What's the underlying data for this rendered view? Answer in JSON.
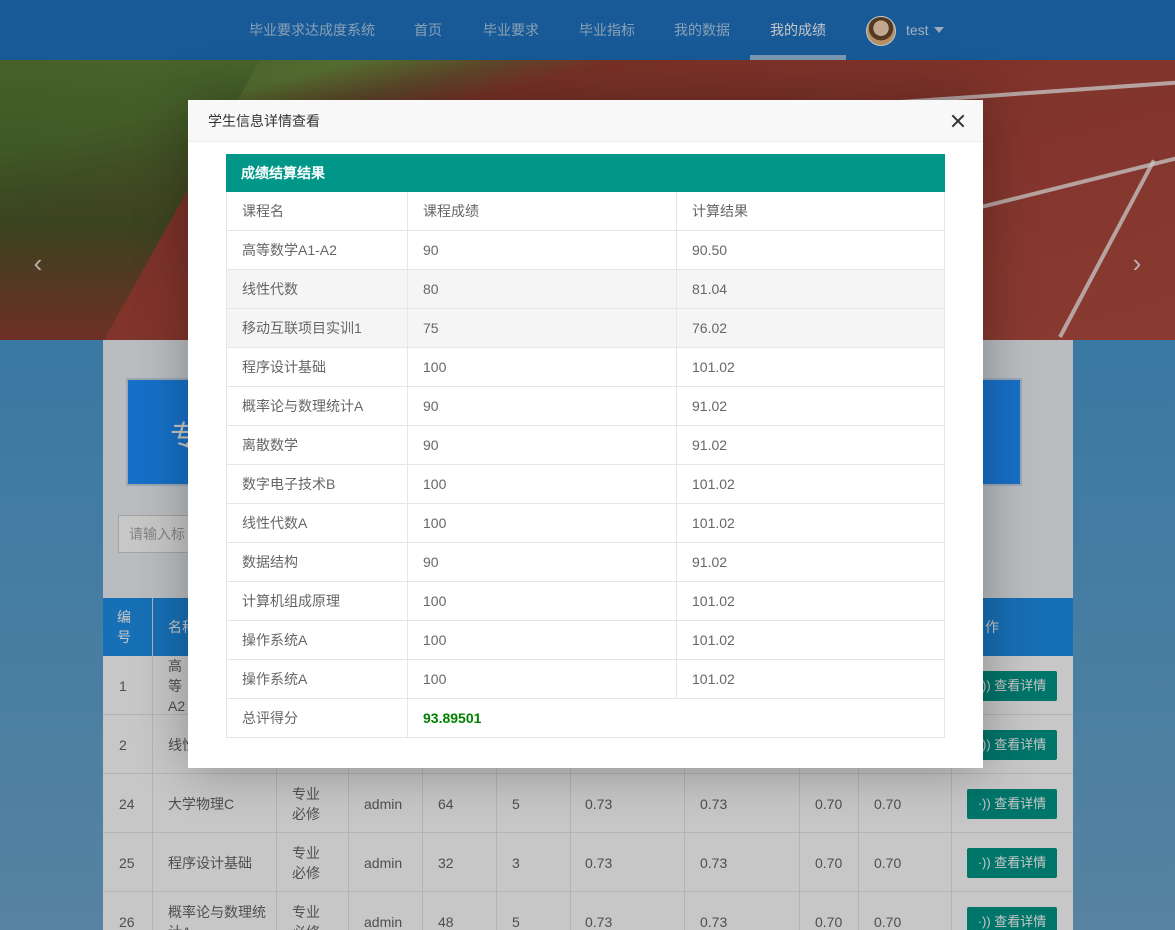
{
  "nav": {
    "items": [
      {
        "label": "毕业要求达成度系统",
        "active": false
      },
      {
        "label": "首页",
        "active": false
      },
      {
        "label": "毕业要求",
        "active": false
      },
      {
        "label": "毕业指标",
        "active": false
      },
      {
        "label": "我的数据",
        "active": false
      },
      {
        "label": "我的成绩",
        "active": true
      }
    ],
    "user": "test"
  },
  "banner": {
    "prev": "‹",
    "next": "›"
  },
  "page": {
    "big_box_text": "专",
    "search_placeholder": "请输入标",
    "grid_headers": [
      "编号",
      "名称",
      "作"
    ],
    "detail_label": "·)) 查看详情",
    "rows": [
      {
        "id": "1",
        "name": "高等A2",
        "type": "",
        "user": "",
        "c5": "",
        "c6": "",
        "c7": "",
        "c8": "",
        "c9": "",
        "c10": ""
      },
      {
        "id": "2",
        "name": "线性",
        "type": "",
        "user": "",
        "c5": "",
        "c6": "",
        "c7": "",
        "c8": "",
        "c9": "",
        "c10": ""
      },
      {
        "id": "24",
        "name": "大学物理C",
        "type": "专业必修",
        "user": "admin",
        "c5": "64",
        "c6": "5",
        "c7": "0.73",
        "c8": "0.73",
        "c9": "0.70",
        "c10": "0.70"
      },
      {
        "id": "25",
        "name": "程序设计基础",
        "type": "专业必修",
        "user": "admin",
        "c5": "32",
        "c6": "3",
        "c7": "0.73",
        "c8": "0.73",
        "c9": "0.70",
        "c10": "0.70"
      },
      {
        "id": "26",
        "name": "概率论与数理统计A",
        "type": "专业必修",
        "user": "admin",
        "c5": "48",
        "c6": "5",
        "c7": "0.73",
        "c8": "0.73",
        "c9": "0.70",
        "c10": "0.70"
      }
    ]
  },
  "modal": {
    "title": "学生信息详情查看",
    "section_title": "成绩结算结果",
    "columns": [
      "课程名",
      "课程成绩",
      "计算结果"
    ],
    "rows": [
      {
        "course": "高等数学A1-A2",
        "score": "90",
        "result": "90.50"
      },
      {
        "course": "线性代数",
        "score": "80",
        "result": "81.04"
      },
      {
        "course": "移动互联项目实训1",
        "score": "75",
        "result": "76.02"
      },
      {
        "course": "程序设计基础",
        "score": "100",
        "result": "101.02"
      },
      {
        "course": "概率论与数理统计A",
        "score": "90",
        "result": "91.02"
      },
      {
        "course": "离散数学",
        "score": "90",
        "result": "91.02"
      },
      {
        "course": "数字电子技术B",
        "score": "100",
        "result": "101.02"
      },
      {
        "course": "线性代数A",
        "score": "100",
        "result": "101.02"
      },
      {
        "course": "数据结构",
        "score": "90",
        "result": "91.02"
      },
      {
        "course": "计算机组成原理",
        "score": "100",
        "result": "101.02"
      },
      {
        "course": "操作系统A",
        "score": "100",
        "result": "101.02"
      },
      {
        "course": "操作系统A",
        "score": "100",
        "result": "101.02"
      }
    ],
    "total_label": "总评得分",
    "total_value": "93.89501"
  },
  "colors": {
    "nav_bg": "#1e74c2",
    "teal": "#009688",
    "total_green": "#008000",
    "grid_header": "#1e8fe8"
  }
}
